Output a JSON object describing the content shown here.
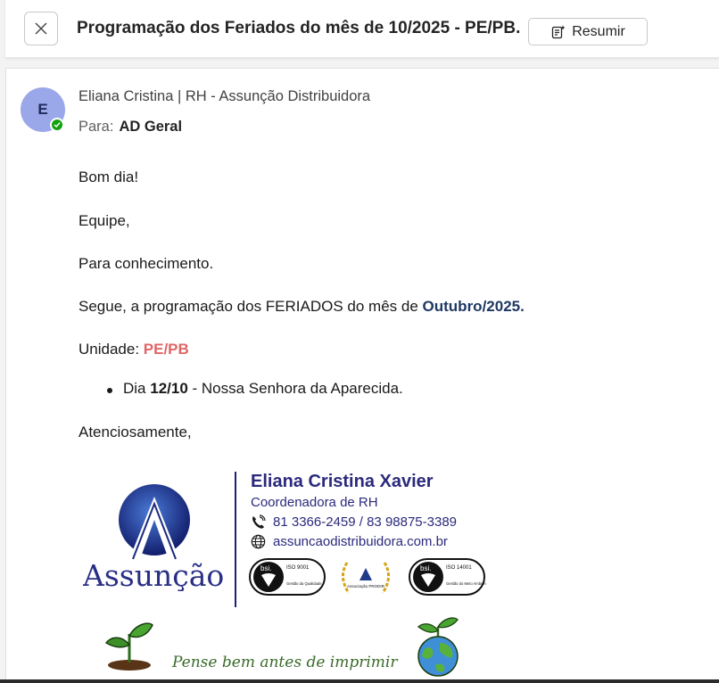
{
  "header": {
    "close_icon": "close-icon",
    "subject": "Programação dos Feriados do mês de 10/2025 - PE/PB.",
    "summarize_label": "Resumir",
    "summarize_icon": "summarize-icon"
  },
  "message": {
    "avatar_initial": "E",
    "presence": "available",
    "sender": "Eliana Cristina | RH - Assunção Distribuidora",
    "to_label": "Para:",
    "recipient": "AD Geral",
    "body": {
      "greeting": "Bom dia!",
      "team": "Equipe,",
      "info": "Para conhecimento.",
      "follows_prefix": "Segue, a programação dos FERIADOS do mês de ",
      "follows_month": "Outubro/2025.",
      "unit_label": "Unidade: ",
      "unit_value": "PE/PB",
      "holiday_prefix": "Dia ",
      "holiday_date": "12/10",
      "holiday_suffix": " - Nossa Senhora da Aparecida.",
      "closing": "Atenciosamente,"
    },
    "signature": {
      "company_logo": "Assunção",
      "name": "Eliana Cristina Xavier",
      "role": "Coordenadora de RH",
      "phones": "81 3366-2459 /  83 98875-3389",
      "website": "assuncaodistribuidora.com.br",
      "badges": {
        "bsi_label": "bsi.",
        "iso9001_code": "ISO 9001",
        "iso9001_desc": "Gestão da Qualidade",
        "prodir_label": "Associação PRODIR",
        "iso14001_code": "ISO 14001",
        "iso14001_desc": "Gestão do Meio Ambiente"
      },
      "slogan": "Pense bem antes de imprimir"
    }
  },
  "colors": {
    "navy": "#1f3864",
    "unit_red": "#e06666",
    "signature_blue": "#2b2a7c",
    "presence_green": "#13a10e",
    "avatar_bg": "#9aa7e8"
  }
}
